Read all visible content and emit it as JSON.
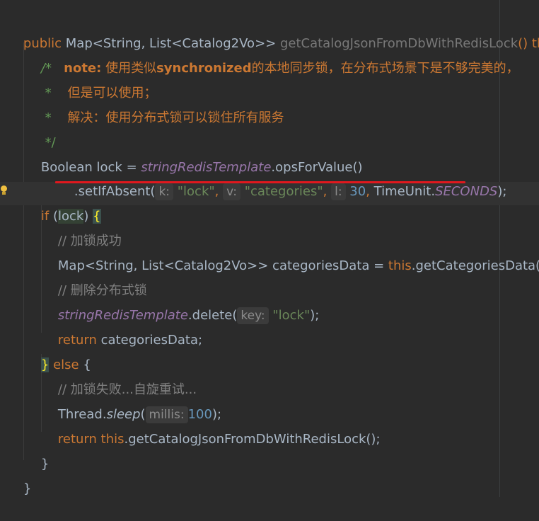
{
  "code": {
    "line1": {
      "kw_public": "public ",
      "type": "Map<String, List<Catalog2Vo>> ",
      "method": "getCatalogJsonFromDbWithRedisLock",
      "tail": "() thr"
    },
    "line2": {
      "open": "/*",
      "todo": "note:",
      "text_a": " 使用类似",
      "sync": "synchronized",
      "text_b": "的本地同步锁，在分布式场景下是不够完美的，"
    },
    "line3": {
      "star": " *",
      "text": "但是可以使用；"
    },
    "line4": {
      "star": " *",
      "text": "解决：使用分布式锁可以锁住所有服务"
    },
    "line5": {
      "close": " */"
    },
    "line6": {
      "type": "Boolean ",
      "var": "lock",
      "eq": " = ",
      "field": "stringRedisTemplate",
      "call": ".opsForValue()"
    },
    "line7": {
      "call": ".setIfAbsent(",
      "hint_k": "k:",
      "arg1": "\"lock\"",
      "comma1": ", ",
      "hint_v": "v:",
      "arg2": "\"categories\"",
      "comma2": ", ",
      "hint_l": "l:",
      "arg3": "30",
      "comma3": ", ",
      "unit": "TimeUnit.",
      "unit_const": "SECONDS",
      "end": ");"
    },
    "line8": {
      "kw_if": "if ",
      "open": "(",
      "var": "lock",
      "close": ") ",
      "brace": "{"
    },
    "line9": {
      "comment": "// 加锁成功"
    },
    "line10": {
      "type": "Map<String, List<Catalog2Vo>> categoriesData = ",
      "kw_this": "this",
      "call": ".getCategoriesData();"
    },
    "line11": {
      "comment": "// 删除分布式锁"
    },
    "line12": {
      "field": "stringRedisTemplate",
      "call": ".delete(",
      "hint_key": "key:",
      "arg": "\"lock\"",
      "end": ");"
    },
    "line13": {
      "kw_return": "return ",
      "rest": "categoriesData;"
    },
    "line14": {
      "brace": "}",
      "kw_else": " else ",
      "open": "{"
    },
    "line15": {
      "comment": "// 加锁失败...自旋重试..."
    },
    "line16": {
      "cls": "Thread.",
      "method": "sleep",
      "open": "(",
      "hint_millis": "millis:",
      "arg": "100",
      "end": ");"
    },
    "line17": {
      "kw_return": "return ",
      "kw_this": "this",
      "call": ".getCatalogJsonFromDbWithRedisLock();"
    },
    "line18": {
      "brace": "}"
    },
    "line19": {
      "brace": "}"
    }
  },
  "colors": {
    "background": "#2b2b2b",
    "keyword": "#cc7832",
    "string": "#6a8759",
    "number": "#6897bb",
    "field": "#9876aa",
    "method_decl": "#ffc66d",
    "comment": "#808080",
    "underline": "#e0181e"
  }
}
